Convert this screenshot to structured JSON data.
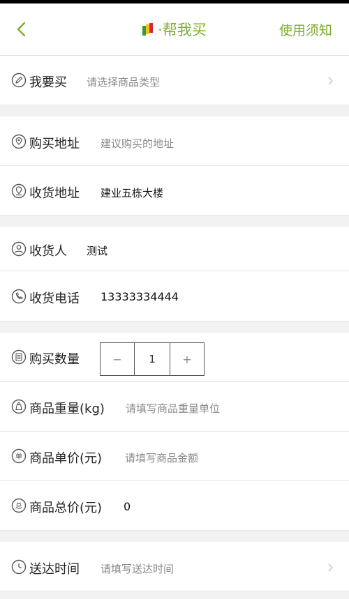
{
  "header": {
    "title": "帮我买",
    "separator": "·",
    "notice_label": "使用须知"
  },
  "form": {
    "want_buy": {
      "label": "我要买",
      "placeholder": "请选择商品类型"
    },
    "buy_address": {
      "label": "购买地址",
      "placeholder": "建议购买的地址"
    },
    "delivery_address": {
      "label": "收货地址",
      "value": "建业五栋大楼"
    },
    "receiver": {
      "label": "收货人",
      "value": "测试"
    },
    "receiver_phone": {
      "label": "收货电话",
      "value": "13333334444"
    },
    "quantity": {
      "label": "购买数量",
      "value": "1",
      "minus": "−",
      "plus": "+"
    },
    "weight": {
      "label": "商品重量(kg)",
      "placeholder": "请填写商品重量单位"
    },
    "unit_price": {
      "label": "商品单价(元)",
      "placeholder": "请填写商品金额"
    },
    "total_price": {
      "label": "商品总价(元)",
      "value": "0"
    },
    "delivery_time": {
      "label": "送达时间",
      "placeholder": "请填写送达时间"
    }
  },
  "colors": {
    "accent": "#7dab2e"
  }
}
